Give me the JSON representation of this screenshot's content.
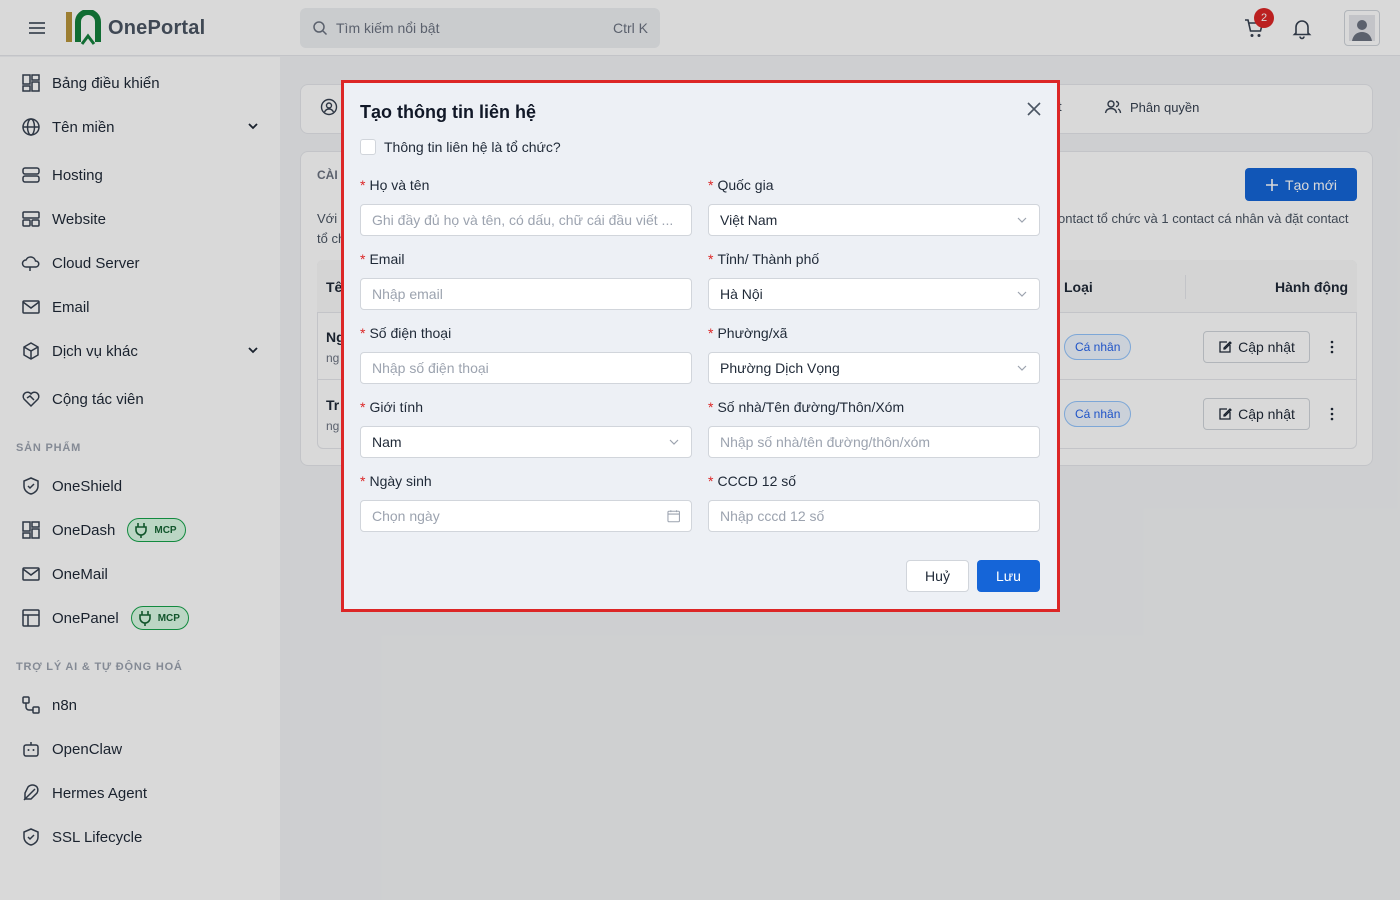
{
  "header": {
    "app_name": "OnePortal",
    "search_placeholder": "Tìm kiếm nổi bật",
    "search_shortcut": "Ctrl K",
    "cart_count": "2"
  },
  "sidebar": {
    "items": [
      {
        "label": "Bảng điều khiển",
        "icon": "dashboard-icon"
      },
      {
        "label": "Tên miền",
        "icon": "globe-icon"
      },
      {
        "label": "Hosting",
        "icon": "server-icon"
      },
      {
        "label": "Website",
        "icon": "website-icon"
      },
      {
        "label": "Cloud Server",
        "icon": "cloud-icon"
      },
      {
        "label": "Email",
        "icon": "mail-icon"
      },
      {
        "label": "Dịch vụ khác",
        "icon": "box-icon"
      },
      {
        "label": "Cộng tác viên",
        "icon": "handshake-icon"
      }
    ],
    "section_products": "SẢN PHẨM",
    "products": [
      {
        "label": "OneShield",
        "icon": "shield-icon"
      },
      {
        "label": "OneDash",
        "icon": "dashboard-icon",
        "badge": "MCP"
      },
      {
        "label": "OneMail",
        "icon": "mail-icon"
      },
      {
        "label": "OnePanel",
        "icon": "panel-icon",
        "badge": "MCP"
      }
    ],
    "section_ai": "TRỢ LÝ AI & TỰ ĐỘNG HOÁ",
    "ai_items": [
      {
        "label": "n8n",
        "icon": "workflow-icon"
      },
      {
        "label": "OpenClaw",
        "icon": "bot-icon"
      },
      {
        "label": "Hermes Agent",
        "icon": "feather-icon"
      },
      {
        "label": "SSL Lifecycle",
        "icon": "shield-check-icon"
      }
    ]
  },
  "main": {
    "tab_right": "Phân quyền",
    "tab_partial": "t",
    "card_title": "CÀI",
    "new_button": "Tạo mới",
    "desc_left_1": "Với",
    "desc_left_2": "tổ ch",
    "desc_right": "ontact tổ chức và 1 contact cá nhân và đặt contact",
    "col_name": "Tê",
    "col_type": "Loại",
    "col_action": "Hành động",
    "rows": [
      {
        "name": "Ng",
        "sub": "ng",
        "type": "Cá nhân",
        "action": "Cập nhật"
      },
      {
        "name": "Tr",
        "sub": "ng",
        "type": "Cá nhân",
        "action": "Cập nhật"
      }
    ]
  },
  "modal": {
    "title": "Tạo thông tin liên hệ",
    "org_checkbox_label": "Thông tin liên hệ là tổ chức?",
    "fields": {
      "fullname": {
        "label": "Họ và tên",
        "placeholder": "Ghi đầy đủ họ và tên, có dấu, chữ cái đầu viết ..."
      },
      "country": {
        "label": "Quốc gia",
        "value": "Việt Nam"
      },
      "email": {
        "label": "Email",
        "placeholder": "Nhập email"
      },
      "province": {
        "label": "Tỉnh/ Thành phố",
        "value": "Hà Nội"
      },
      "phone": {
        "label": "Số điện thoại",
        "placeholder": "Nhập số điện thoại"
      },
      "ward": {
        "label": "Phường/xã",
        "value": "Phường Dịch Vọng"
      },
      "gender": {
        "label": "Giới tính",
        "value": "Nam"
      },
      "address": {
        "label": "Số nhà/Tên đường/Thôn/Xóm",
        "placeholder": "Nhập số nhà/tên đường/thôn/xóm"
      },
      "dob": {
        "label": "Ngày sinh",
        "placeholder": "Chọn ngày"
      },
      "cccd": {
        "label": "CCCD 12 số",
        "placeholder": "Nhập cccd 12 số"
      }
    },
    "cancel": "Huỷ",
    "save": "Lưu"
  },
  "colors": {
    "primary": "#1565d8",
    "required": "#dc2626",
    "highlight_border": "#dc2626",
    "brand_green": "#16a34a"
  }
}
